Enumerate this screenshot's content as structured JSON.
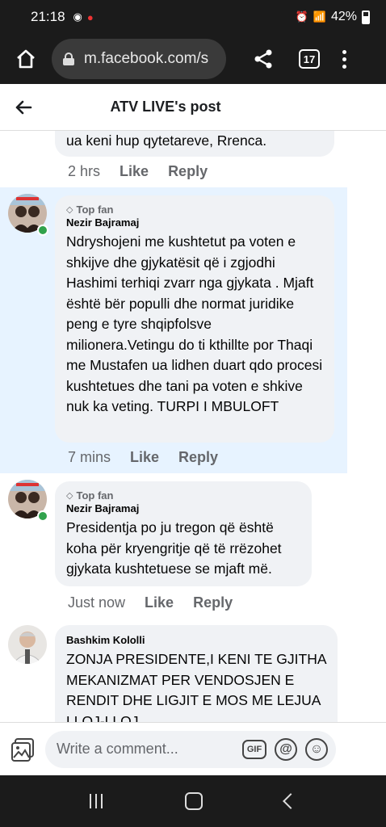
{
  "status_bar": {
    "time": "21:18",
    "battery": "42%"
  },
  "browser": {
    "url": "m.facebook.com/s",
    "tab_count": "17"
  },
  "header": {
    "title": "ATV LIVE's post"
  },
  "comments": [
    {
      "text": "ua keni hup qytetareve, Rrenca.",
      "time": "2 hrs",
      "like": "Like",
      "reply": "Reply"
    },
    {
      "badge": "Top fan",
      "name": "Nezir Bajramaj",
      "text": "Ndryshojeni me kushtetut pa voten e shkijve dhe gjykatësit që i zgjodhi Hashimi terhiqi zvarr nga gjykata . Mjaft është bër populli dhe normat juridike peng e tyre shqipfolsve milionera.Vetingu do ti kthillte por Thaqi me Mustafen ua lidhen duart qdo procesi kushtetues  dhe tani pa voten e shkive nuk ka veting. TURPI I MBULOFT",
      "time": "7 mins",
      "like": "Like",
      "reply": "Reply"
    },
    {
      "badge": "Top fan",
      "name": "Nezir Bajramaj",
      "text": "Presidentja po ju tregon që është koha për kryengritje që të rrëzohet gjykata kushtetuese se mjaft më.",
      "time": "Just now",
      "like": "Like",
      "reply": "Reply"
    },
    {
      "name": "Bashkim Kololli",
      "text": "ZONJA PRESIDENTE,I KENI TE GJITHA MEKANIZMAT PER VENDOSJEN E RENDIT DHE LIGJIT E MOS ME LEJUA LLOJ-LLOJ"
    }
  ],
  "composer": {
    "placeholder": "Write a comment...",
    "gif_label": "GIF"
  },
  "colors": {
    "highlight": "#e7f3ff",
    "online": "#31a24c",
    "bubble": "#f0f2f5"
  }
}
